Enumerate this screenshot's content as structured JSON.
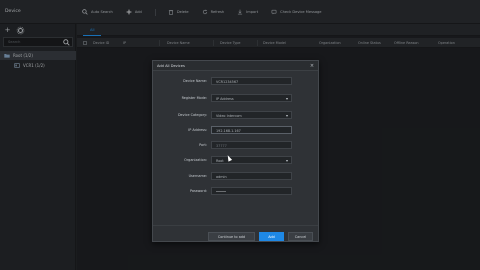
{
  "window": {
    "title": "Device"
  },
  "toolbar": {
    "items": [
      {
        "label": "Auto Search",
        "icon": "search-icon"
      },
      {
        "label": "Add",
        "icon": "plus-icon"
      },
      {
        "label": "Delete",
        "icon": "trash-icon"
      },
      {
        "label": "Refresh",
        "icon": "refresh-icon"
      },
      {
        "label": "Import",
        "icon": "import-icon"
      },
      {
        "label": "Check Device Message",
        "icon": "message-icon"
      }
    ]
  },
  "sidebar": {
    "search_placeholder": "Search",
    "tree": [
      {
        "label": "Root (1/2)",
        "icon": "folder-icon",
        "selected": true
      },
      {
        "label": "VCR1 (1/2)",
        "icon": "device-icon",
        "selected": false
      }
    ]
  },
  "main": {
    "tab_label": "All",
    "columns": [
      "Device ID",
      "IP",
      "Device Name",
      "Device Type",
      "Device Model",
      "Organization",
      "Online Status",
      "Offline Reason",
      "Operation"
    ]
  },
  "dialog": {
    "title": "Add All Devices",
    "fields": [
      {
        "label": "Device Name:",
        "value": "VCR1234567",
        "type": "text"
      },
      {
        "label": "Register Mode:",
        "value": "IP Address",
        "type": "select"
      },
      {
        "label": "Device Category:",
        "value": "Video Intercom",
        "type": "select"
      },
      {
        "label": "IP Address:",
        "value": "192.168.1.167",
        "type": "text",
        "focused": true
      },
      {
        "label": "Port:",
        "value": "37777",
        "type": "text",
        "placeholder": true
      },
      {
        "label": "Organization:",
        "value": "Root",
        "type": "select"
      },
      {
        "label": "Username:",
        "value": "admin",
        "type": "text"
      },
      {
        "label": "Password:",
        "value": "•••••",
        "type": "password"
      }
    ],
    "buttons": {
      "continue": "Continue to add",
      "add": "Add",
      "cancel": "Cancel"
    }
  },
  "colors": {
    "accent": "#1e88e5",
    "background": "#1f2124"
  }
}
